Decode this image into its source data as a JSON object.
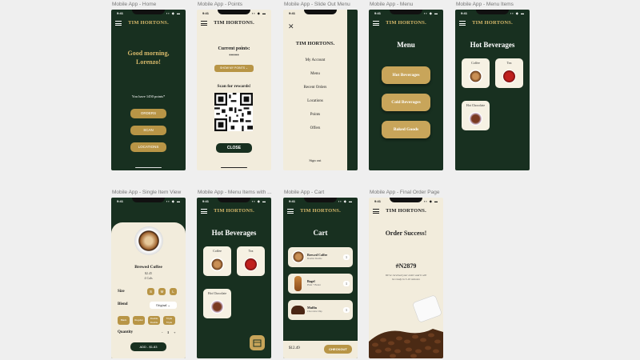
{
  "frames": [
    {
      "label": "Mobile App - Home"
    },
    {
      "label": "Mobile App - Points"
    },
    {
      "label": "Mobile App - Slide Out Menu"
    },
    {
      "label": "Mobile App - Menu"
    },
    {
      "label": "Mobile App - Menu Items"
    },
    {
      "label": "Mobile App - Single Item View"
    },
    {
      "label": "Mobile App - Menu Items with ..."
    },
    {
      "label": "Mobile App - Cart"
    },
    {
      "label": "Mobile App - Final Order Page"
    }
  ],
  "status": {
    "time": "9:41",
    "signal": "▪▪ ◆ ▬"
  },
  "brand": "TIM HORTONS.",
  "home": {
    "greeting": "Good morning,",
    "name": "Lorenzo!",
    "points_text": "You have 1450 points*",
    "buttons": [
      "ORDERS",
      "SCAN",
      "LOCATIONS"
    ]
  },
  "points": {
    "title": "Current points:",
    "masked": "*****",
    "reveal_label": "SHOW MY POINTS",
    "scan_label": "Scan for rewards!",
    "close_label": "CLOSE"
  },
  "slide_menu": {
    "close_glyph": "✕",
    "items": [
      "My Account",
      "Menu",
      "Recent Orders",
      "Locations",
      "Points",
      "Offers"
    ],
    "sign_out": "Sign out"
  },
  "menu": {
    "title": "Menu",
    "items": [
      "Hot Beverages",
      "Cold Beverages",
      "Baked Goods"
    ]
  },
  "menu_items": {
    "title": "Hot Beverages",
    "cards": [
      "Coffee",
      "Tea",
      "Hot Chocolate"
    ]
  },
  "single_item": {
    "name": "Brewed Coffee",
    "price": "$2.45",
    "calories": "4 Cals",
    "size_label": "Size",
    "sizes": [
      "S",
      "M",
      "L"
    ],
    "blend_label": "Blend",
    "blend_value": "Original",
    "options": [
      "Black",
      "Regular",
      "Double Double",
      "Triple Triple"
    ],
    "quantity_label": "Quantity",
    "quantity_minus": "-",
    "quantity_value": "1",
    "quantity_plus": "+",
    "add_label": "ADD - $1.83"
  },
  "menu_items_cart": {
    "title": "Hot Beverages",
    "cards": [
      "Coffee",
      "Tea",
      "Hot Chocolate"
    ]
  },
  "cart": {
    "title": "Cart",
    "items": [
      {
        "name": "Brewed Coffee",
        "sub": "Double Double",
        "qty": "1"
      },
      {
        "name": "Bagel",
        "sub": "Plain + Butter",
        "qty": "1"
      },
      {
        "name": "Muffin",
        "sub": "Chocolate Chip",
        "qty": "1"
      }
    ],
    "total": "$12.49",
    "checkout_label": "CHECKOUT"
  },
  "final": {
    "title": "Order Success!",
    "order_number": "#N2879",
    "message_line1": "We've received your order and it will",
    "message_line2": "be ready in 5-10 minutes"
  },
  "colors": {
    "dark_green": "#183020",
    "cream": "#f2ecdc",
    "gold": "#b89546"
  }
}
